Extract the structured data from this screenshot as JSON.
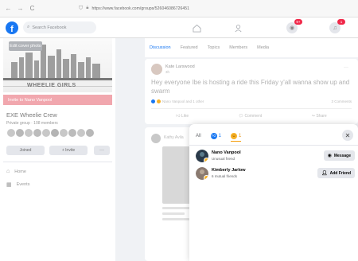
{
  "browser": {
    "back": "←",
    "forward": "→",
    "reload": "C",
    "url": "https://www.facebook.com/groups/526046086726451"
  },
  "fb_nav": {
    "logo": "f",
    "search_placeholder": "Search Facebook",
    "badge_count": "9+",
    "badge_count2": "1"
  },
  "sidebar": {
    "edit_photo": "Edit cover photo",
    "cover_text": "WHEELIE GIRLS",
    "invite_bar": "Invite to Nano Vanpool",
    "group_name": "EXE Wheelie Crew",
    "group_meta": "Private group · 108 members",
    "joined": "Joined",
    "invite": "+ Invite",
    "more": "···",
    "nav_home": "Home",
    "nav_events": "Events"
  },
  "main": {
    "tabs": [
      "Discussion",
      "Featured",
      "Topics",
      "Members",
      "Media"
    ],
    "post1": {
      "author": "Kate Larswood",
      "time": "3h",
      "dots": "···",
      "body": "Hey everyone Ibe is hosting a ride this Friday y'all wanna show up and swarm",
      "reactions": "Nano Vanpool and 1 other",
      "comments": "3 Comments",
      "actions": [
        "Like",
        "Comment",
        "Share"
      ]
    },
    "post2": {
      "author": "Kathy Avila"
    }
  },
  "popup": {
    "tab_all": "All",
    "tab_like_count": "1",
    "tab_haha_count": "1",
    "close": "✕",
    "people": [
      {
        "name": "Nano Vanpool",
        "mutual": "Unusual friend",
        "button": "Message",
        "icon": "messenger-icon"
      },
      {
        "name": "Kimberly Jarlow",
        "mutual": "6 mutual friends",
        "button": "Add Friend",
        "icon": "add-friend-icon"
      }
    ]
  },
  "colors": {
    "fb_blue": "#1877f2",
    "invite_pink": "#f1a7ae",
    "haha_yellow": "#f7b125"
  }
}
